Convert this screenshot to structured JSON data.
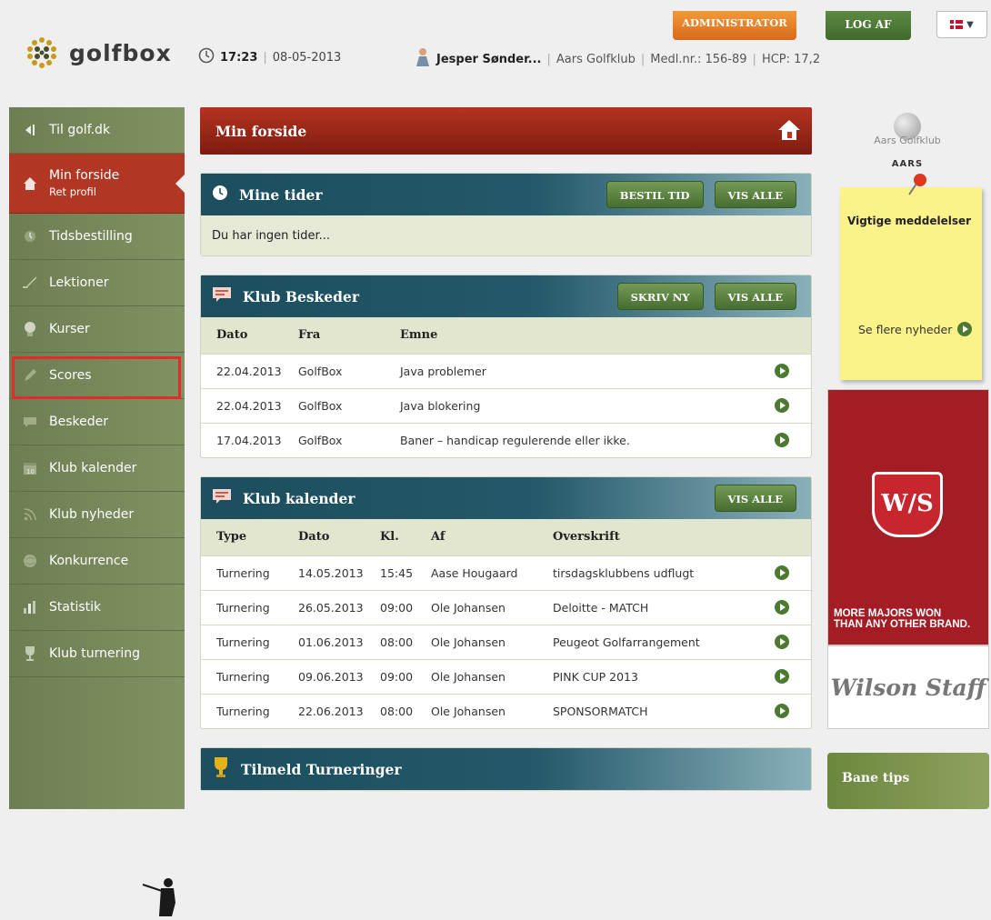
{
  "header": {
    "logo_text": "golfbox",
    "time": "17:23",
    "date": "08-05-2013",
    "user_name": "Jesper Sønder...",
    "club": "Aars Golfklub",
    "member_no": "Medl.nr.: 156-89",
    "hcp": "HCP: 17,2",
    "admin_label": "ADMINISTRATOR",
    "logout_label": "LOG AF"
  },
  "sidebar": {
    "items": [
      {
        "label": "Til golf.dk"
      },
      {
        "label": "Min forside",
        "sub": "Ret profil"
      },
      {
        "label": "Tidsbestilling"
      },
      {
        "label": "Lektioner"
      },
      {
        "label": "Kurser"
      },
      {
        "label": "Scores"
      },
      {
        "label": "Beskeder"
      },
      {
        "label": "Klub kalender"
      },
      {
        "label": "Klub nyheder"
      },
      {
        "label": "Konkurrence"
      },
      {
        "label": "Statistik"
      },
      {
        "label": "Klub turnering"
      }
    ]
  },
  "main": {
    "page_title": "Min forside",
    "mine_tider": {
      "title": "Mine tider",
      "btn_book": "BESTIL TID",
      "btn_all": "VIS ALLE",
      "empty": "Du har ingen tider..."
    },
    "beskeder": {
      "title": "Klub Beskeder",
      "btn_new": "SKRIV NY",
      "btn_all": "VIS ALLE",
      "columns": [
        "Dato",
        "Fra",
        "Emne"
      ],
      "rows": [
        [
          "22.04.2013",
          "GolfBox",
          "Java problemer"
        ],
        [
          "22.04.2013",
          "GolfBox",
          "Java blokering"
        ],
        [
          "17.04.2013",
          "GolfBox",
          "Baner – handicap regulerende eller ikke."
        ]
      ]
    },
    "kalender": {
      "title": "Klub kalender",
      "btn_all": "VIS ALLE",
      "columns": [
        "Type",
        "Dato",
        "Kl.",
        "Af",
        "Overskrift"
      ],
      "rows": [
        [
          "Turnering",
          "14.05.2013",
          "15:45",
          "Aase Hougaard",
          "tirsdagsklubbens udflugt"
        ],
        [
          "Turnering",
          "26.05.2013",
          "09:00",
          "Ole Johansen",
          "Deloitte - MATCH"
        ],
        [
          "Turnering",
          "01.06.2013",
          "08:00",
          "Ole Johansen",
          "Peugeot Golfarrangement"
        ],
        [
          "Turnering",
          "09.06.2013",
          "09:00",
          "Ole Johansen",
          "PINK CUP 2013"
        ],
        [
          "Turnering",
          "22.06.2013",
          "08:00",
          "Ole Johansen",
          "SPONSORMATCH"
        ]
      ]
    },
    "tilmeld": {
      "title": "Tilmeld Turneringer"
    }
  },
  "right": {
    "club_logo_text": "Aars Golfklub",
    "club_name": "AARS",
    "note_title": "Vigtige meddelelser",
    "note_link": "Se flere nyheder",
    "ad_logo": "W/S",
    "ad_slogan_1": "MORE MAJORS WON",
    "ad_slogan_2": "THAN ANY OTHER BRAND.",
    "ad_brand": "Wilson Staff",
    "bane_tips": "Bane tips"
  }
}
